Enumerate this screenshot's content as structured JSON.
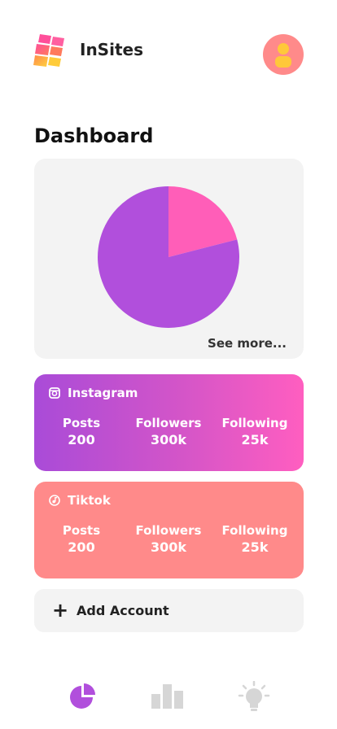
{
  "header": {
    "app_title": "InSites",
    "logo_icon": "stacked-tiles-logo",
    "avatar_icon": "user-icon"
  },
  "page": {
    "title": "Dashboard"
  },
  "chart": {
    "see_more_label": "See more...",
    "chart_data": {
      "type": "pie",
      "values": [
        21,
        79
      ],
      "colors": [
        "#ff5eb8",
        "#b14fdc"
      ],
      "start_angle": "12 o'clock",
      "direction": "clockwise"
    }
  },
  "accounts": {
    "instagram": {
      "name": "Instagram",
      "icon": "instagram-icon",
      "posts_label": "Posts",
      "posts_value": "200",
      "followers_label": "Followers",
      "followers_value": "300k",
      "following_label": "Following",
      "following_value": "25k"
    },
    "tiktok": {
      "name": "Tiktok",
      "icon": "tiktok-icon",
      "posts_label": "Posts",
      "posts_value": "200",
      "followers_label": "Followers",
      "followers_value": "300k",
      "following_label": "Following",
      "following_value": "25k"
    }
  },
  "add_account": {
    "icon": "plus-icon",
    "label": "Add Account"
  },
  "nav": {
    "items": [
      {
        "icon": "pie-chart-icon",
        "active": true
      },
      {
        "icon": "bar-chart-icon",
        "active": false
      },
      {
        "icon": "lightbulb-icon",
        "active": false
      }
    ]
  },
  "colors": {
    "accent_purple": "#b14fdc",
    "accent_pink": "#ff5eb8",
    "tiktok_card": "#ff8a8a",
    "nav_inactive": "#d6d6d6"
  }
}
